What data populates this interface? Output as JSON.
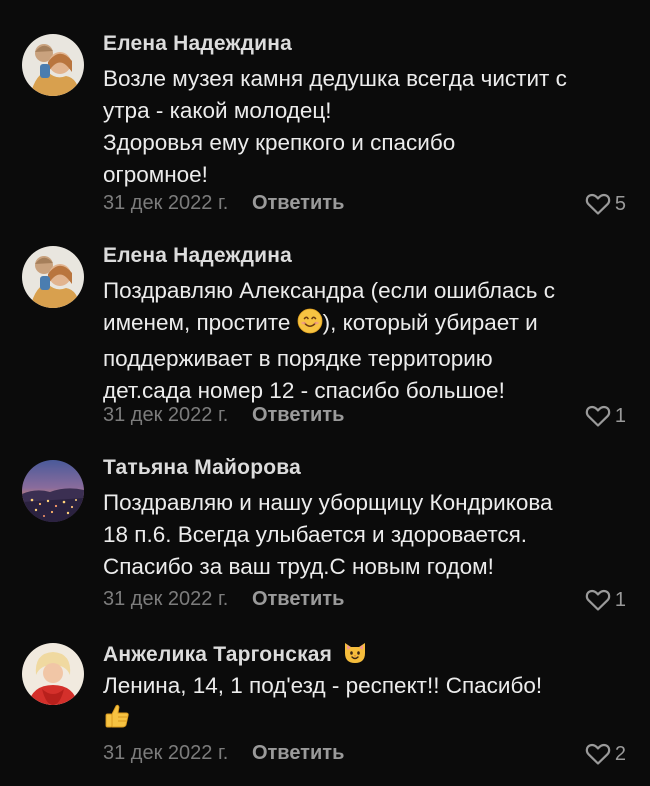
{
  "comments": [
    {
      "author": "Елена Надеждина",
      "lines": [
        "Возле музея камня дедушка всегда чистит с",
        "утра - какой молодец!",
        "Здоровья ему крепкого и спасибо",
        "огромное!"
      ],
      "date": "31 дек 2022 г.",
      "reply_label": "Ответить",
      "likes": "5"
    },
    {
      "author": "Елена Надеждина",
      "lines": [
        "Поздравляю Александра (если ошиблась с",
        "именем, простите",
        "), который убирает и",
        "поддерживает в порядке территорию",
        "дет.сада номер 12 - спасибо большое!"
      ],
      "date": "31 дек 2022 г.",
      "reply_label": "Ответить",
      "likes": "1"
    },
    {
      "author": "Татьяна Майорова",
      "lines": [
        "Поздравляю и нашу уборщицу Кондрикова",
        "18 п.6. Всегда улыбается и здоровается.",
        "Спасибо за ваш труд.С новым годом!"
      ],
      "date": "31 дек 2022 г.",
      "reply_label": "Ответить",
      "likes": "1"
    },
    {
      "author": "Анжелика Таргонская",
      "lines": [
        "Ленина, 14, 1 под'езд - респект!! Спасибо!"
      ],
      "date": "31 дек 2022 г.",
      "reply_label": "Ответить",
      "likes": "2"
    }
  ],
  "icons": {
    "like": "heart-outline-icon",
    "smile_emoji": "smiling-face-emoji",
    "cat_emoji": "cat-face-emoji",
    "thumbs_emoji": "thumbs-up-emoji"
  },
  "colors": {
    "background": "#0b0b0b",
    "text": "#ececec",
    "muted": "#7c7c7c",
    "action": "#9a9a9a"
  }
}
